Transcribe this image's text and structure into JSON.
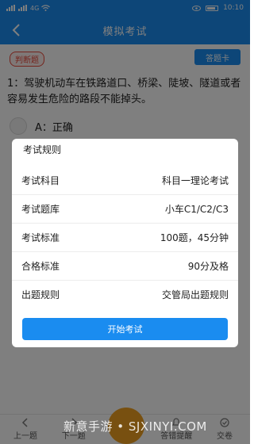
{
  "status_bar": {
    "time": "10:10",
    "network": "4G"
  },
  "nav": {
    "title": "模拟考试",
    "back_icon": "chevron-left-icon"
  },
  "question": {
    "type_tag": "判断题",
    "answer_card_label": "答题卡",
    "text": "1：驾驶机动车在铁路道口、桥梁、陡坡、隧道或者容易发生危险的路段不能掉头。",
    "option_a": "A：正确"
  },
  "bottom_bar": {
    "prev_label": "上一题",
    "next_label": "下一题",
    "answer_hint_label": "答错提醒",
    "submit_label": "交卷"
  },
  "dialog": {
    "title": "考试规则",
    "rows": [
      {
        "label": "考试科目",
        "value": "科目一理论考试"
      },
      {
        "label": "考试题库",
        "value": "小车C1/C2/C3"
      },
      {
        "label": "考试标准",
        "value": "100题，45分钟"
      },
      {
        "label": "合格标准",
        "value": "90分及格"
      },
      {
        "label": "出题规则",
        "value": "交管局出题规则"
      }
    ],
    "start_button": "开始考试"
  },
  "watermark": "新意手游 • SJXINYI.COM",
  "colors": {
    "primary": "#1a8cf0",
    "tag_red": "#e8483a",
    "badge_orange": "#f0a020"
  }
}
